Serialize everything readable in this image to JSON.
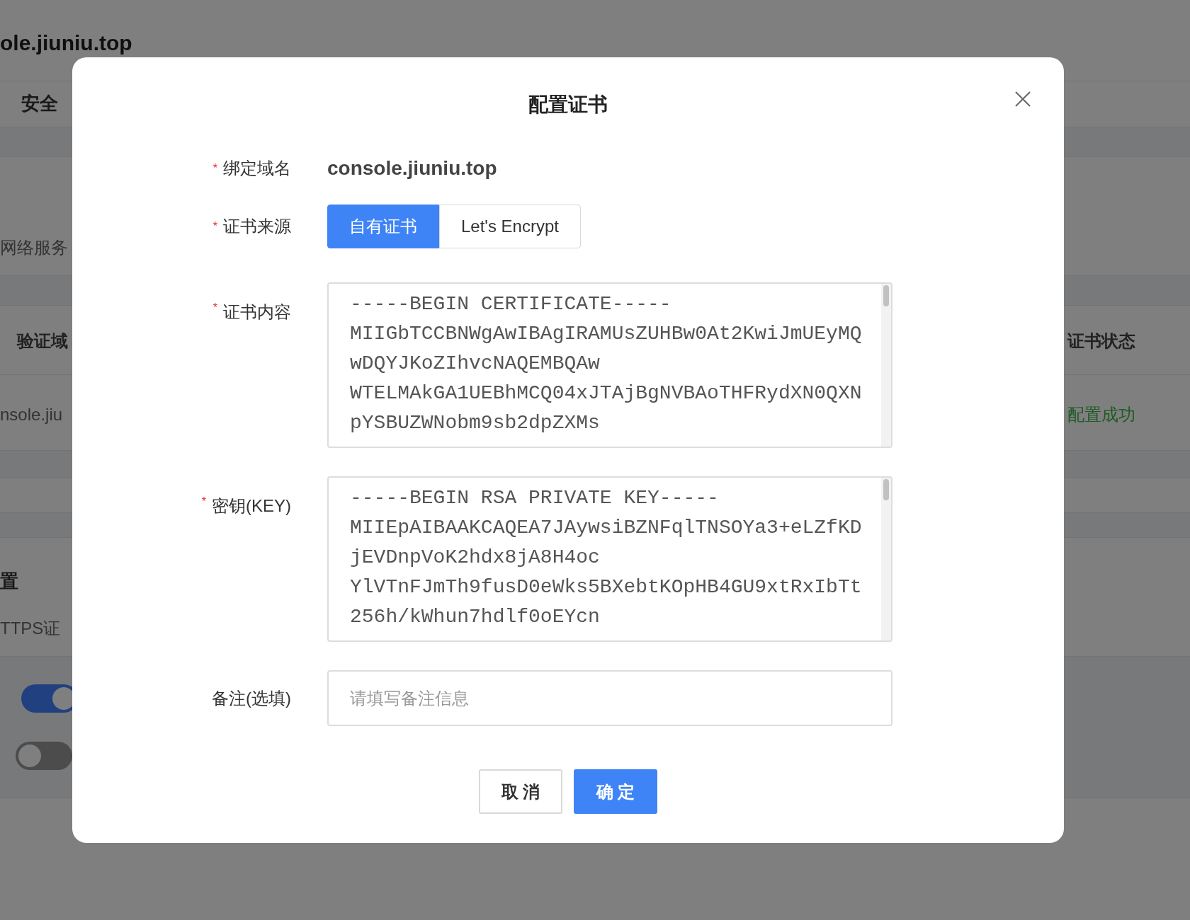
{
  "background": {
    "title": "ole.jiuniu.top",
    "tab": "安全",
    "section_text": "网络服务",
    "table": {
      "columns": [
        "验证域",
        "证书状态"
      ],
      "rows": [
        [
          "nsole.jiu",
          "配置成功"
        ]
      ]
    },
    "heading": "置",
    "description": "TTPS证",
    "toggles": [
      {
        "on": true
      },
      {
        "on": false
      }
    ]
  },
  "dialog": {
    "title": "配置证书",
    "fields": [
      {
        "kind": "text",
        "label": "绑定域名",
        "required_mark": "*",
        "value": "console.jiuniu.top"
      },
      {
        "kind": "segmented",
        "label": "证书来源",
        "required_mark": "*",
        "options": [
          {
            "label": "自有证书",
            "selected": true
          },
          {
            "label": "Let's Encrypt",
            "selected": false
          }
        ]
      },
      {
        "kind": "textarea",
        "label": "证书内容",
        "required_mark": "*",
        "value": "-----BEGIN CERTIFICATE-----\nMIIGbTCCBNWgAwIBAgIRAMUsZUHBw0At2KwiJmUEyMQ\nwDQYJKoZIhvcNAQEMBQAw\nWTELMAkGA1UEBhMCQ04xJTAjBgNVBAoTHFRydXN0QXN\npYSBUZWNobm9sb2dpZXMs"
      },
      {
        "kind": "textarea",
        "label": "密钥(KEY)",
        "required_mark": "*",
        "value": "-----BEGIN RSA PRIVATE KEY-----\nMIIEpAIBAAKCAQEA7JAywsiBZNFqlTNSOYa3+eLZfKD\njEVDnpVoK2hdx8jA8H4oc\nYlVTnFJmTh9fusD0eWks5BXebtKOpHB4GU9xtRxIbTt\n256h/kWhun7hdlf0oEYcn"
      },
      {
        "kind": "input",
        "label": "备注(选填)",
        "placeholder": "请填写备注信息"
      }
    ],
    "buttons": [
      {
        "label": "取 消",
        "kind": "secondary"
      },
      {
        "label": "确 定",
        "kind": "primary"
      }
    ]
  }
}
